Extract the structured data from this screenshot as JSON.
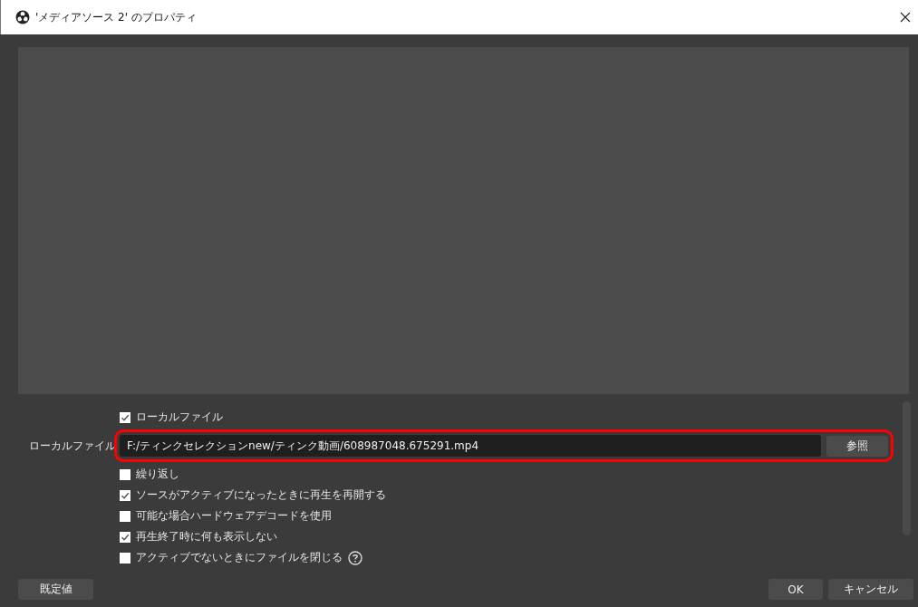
{
  "window": {
    "title": "'メディアソース 2' のプロパティ"
  },
  "form_rows": [
    {
      "kind": "checkbox",
      "label": "ローカルファイル",
      "checked": true,
      "help": false
    },
    {
      "kind": "file",
      "label": "ローカルファイル",
      "value": "F:/ティンクセレクションnew/ティンク動画/608987048.675291.mp4",
      "button": "参照",
      "highlighted": true
    },
    {
      "kind": "checkbox",
      "label": "繰り返し",
      "checked": false,
      "help": false
    },
    {
      "kind": "checkbox",
      "label": "ソースがアクティブになったときに再生を再開する",
      "checked": true,
      "help": false
    },
    {
      "kind": "checkbox",
      "label": "可能な場合ハードウェアデコードを使用",
      "checked": false,
      "help": false
    },
    {
      "kind": "checkbox",
      "label": "再生終了時に何も表示しない",
      "checked": true,
      "help": false
    },
    {
      "kind": "checkbox",
      "label": "アクティブでないときにファイルを閉じる",
      "checked": false,
      "help": true
    }
  ],
  "buttons": [
    {
      "kind": "defaults",
      "label": "既定値"
    },
    {
      "kind": "ok",
      "label": "OK"
    },
    {
      "kind": "cancel",
      "label": "キャンセル"
    }
  ]
}
